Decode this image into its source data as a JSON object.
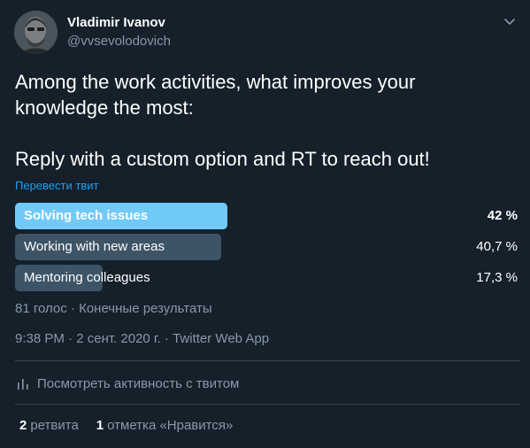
{
  "author": {
    "display_name": "Vladimir Ivanov",
    "handle": "@vvsevolodovich"
  },
  "tweet": {
    "lines": [
      "Among the work activities, what improves your",
      "knowledge the most:",
      "",
      "Reply with a custom option and RT to reach out!"
    ],
    "translate_link": "Перевести твит"
  },
  "poll": {
    "options": [
      {
        "label": "Solving tech issues",
        "percent_text": "42 %",
        "percent": 42,
        "winner": true
      },
      {
        "label": "Working with new areas",
        "percent_text": "40,7 %",
        "percent": 40.7,
        "winner": false
      },
      {
        "label": "Mentoring colleagues",
        "percent_text": "17,3 %",
        "percent": 17.3,
        "winner": false
      }
    ],
    "meta": "81 голос · Конечные результаты"
  },
  "timestamp": {
    "time": "9:38 PM",
    "separator": " · ",
    "date": "2 сент. 2020 г.",
    "source": "Twitter Web App"
  },
  "activity_link": "Посмотреть активность с твитом",
  "stats": {
    "retweets_count": "2",
    "retweets_label": "ретвита",
    "likes_count": "1",
    "likes_label": "отметка «Нравится»"
  },
  "colors": {
    "background": "#15202b",
    "winner_bar": "#71c9f8",
    "other_bar": "#3d5466",
    "secondary_text": "#8899a6",
    "link": "#1da1f2",
    "divider": "#38444d"
  },
  "icons": {
    "caret": "chevron-down-icon",
    "activity": "bar-chart-icon"
  }
}
